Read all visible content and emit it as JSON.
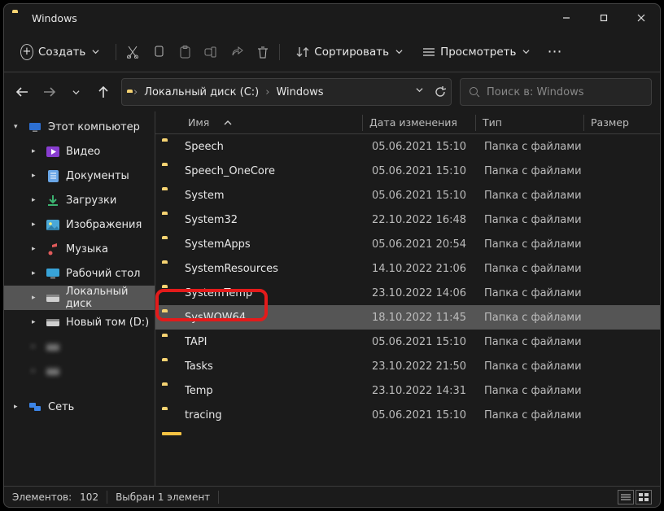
{
  "window_title": "Windows",
  "toolbar": {
    "create": "Создать",
    "sort": "Сортировать",
    "view": "Просмотреть"
  },
  "breadcrumb": {
    "disk": "Локальный диск (C:)",
    "folder": "Windows"
  },
  "search": {
    "placeholder": "Поиск в: Windows"
  },
  "columns": {
    "name": "Имя",
    "date": "Дата изменения",
    "type": "Тип",
    "size": "Размер"
  },
  "sidebar": {
    "this_pc": "Этот компьютер",
    "items": [
      {
        "label": "Видео",
        "icon": "video"
      },
      {
        "label": "Документы",
        "icon": "docs"
      },
      {
        "label": "Загрузки",
        "icon": "download"
      },
      {
        "label": "Изображения",
        "icon": "pictures"
      },
      {
        "label": "Музыка",
        "icon": "music"
      },
      {
        "label": "Рабочий стол",
        "icon": "desktop"
      },
      {
        "label": "Локальный диск",
        "icon": "disk",
        "selected": true
      },
      {
        "label": "Новый том (D:)",
        "icon": "disk"
      },
      {
        "label": "",
        "icon": "disk",
        "blur": true
      },
      {
        "label": "",
        "icon": "disk",
        "blur": true
      }
    ],
    "network": "Сеть"
  },
  "rows": [
    {
      "name": "Speech",
      "date": "05.06.2021 15:10",
      "type": "Папка с файлами"
    },
    {
      "name": "Speech_OneCore",
      "date": "05.06.2021 15:10",
      "type": "Папка с файлами"
    },
    {
      "name": "System",
      "date": "05.06.2021 15:10",
      "type": "Папка с файлами"
    },
    {
      "name": "System32",
      "date": "22.10.2022 16:48",
      "type": "Папка с файлами"
    },
    {
      "name": "SystemApps",
      "date": "05.06.2021 20:54",
      "type": "Папка с файлами"
    },
    {
      "name": "SystemResources",
      "date": "14.10.2022 21:06",
      "type": "Папка с файлами"
    },
    {
      "name": "SystemTemp",
      "date": "23.10.2022 14:06",
      "type": "Папка с файлами"
    },
    {
      "name": "SysWOW64",
      "date": "18.10.2022 11:45",
      "type": "Папка с файлами",
      "selected": true,
      "highlight": true
    },
    {
      "name": "TAPI",
      "date": "05.06.2021 15:10",
      "type": "Папка с файлами"
    },
    {
      "name": "Tasks",
      "date": "23.10.2022 21:50",
      "type": "Папка с файлами"
    },
    {
      "name": "Temp",
      "date": "23.10.2022 14:31",
      "type": "Папка с файлами"
    },
    {
      "name": "tracing",
      "date": "05.06.2021 15:10",
      "type": "Папка с файлами"
    }
  ],
  "status": {
    "count_label": "Элементов:",
    "count": "102",
    "selected": "Выбран 1 элемент"
  }
}
